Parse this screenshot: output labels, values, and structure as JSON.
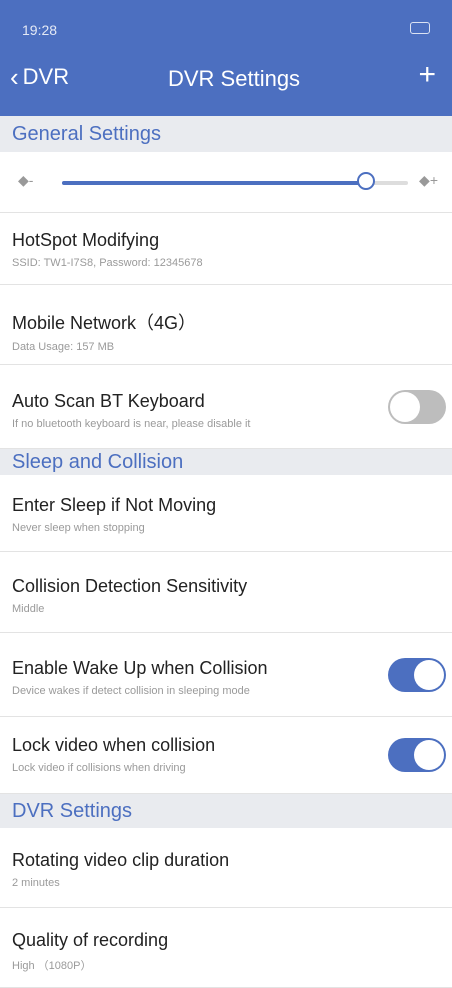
{
  "status": {
    "time": "19:28 ",
    "signal": "",
    "battery": ""
  },
  "nav": {
    "back_label": "DVR",
    "title": "DVR Settings",
    "plus": "+"
  },
  "sections": {
    "general": "General Settings",
    "sleep": "Sleep and Collision",
    "dvr": "DVR Settings"
  },
  "volume": {
    "level": 0.88
  },
  "items": {
    "hotspot": {
      "title": "HotSpot Modifying",
      "sub": "SSID:  TW1-I7S8, Password:  12345678"
    },
    "mobile": {
      "title": "Mobile Network（4G）",
      "sub": "Data Usage:  157 MB"
    },
    "autoscan": {
      "title": "Auto Scan BT Keyboard",
      "sub": "If no bluetooth keyboard is near, please disable it",
      "enabled": false
    },
    "sleep": {
      "title": "Enter Sleep if Not Moving",
      "sub": "Never sleep when stopping"
    },
    "sensitivity": {
      "title": "Collision Detection Sensitivity",
      "sub": "Middle"
    },
    "wakeup": {
      "title": "Enable Wake Up when Collision",
      "sub": "Device wakes if detect collision in sleeping mode",
      "enabled": true
    },
    "lockvideo": {
      "title": "Lock video when collision",
      "sub": "Lock video if collisions when driving",
      "enabled": true
    },
    "rotating": {
      "title": "Rotating video clip duration",
      "sub": "2 minutes"
    },
    "quality": {
      "title": "Quality of recording",
      "sub": "High  （1080P）"
    }
  },
  "colors": {
    "accent": "#4c6fc0",
    "toggle_off": "#bdbdbd",
    "section_bg": "#e9ebef"
  }
}
